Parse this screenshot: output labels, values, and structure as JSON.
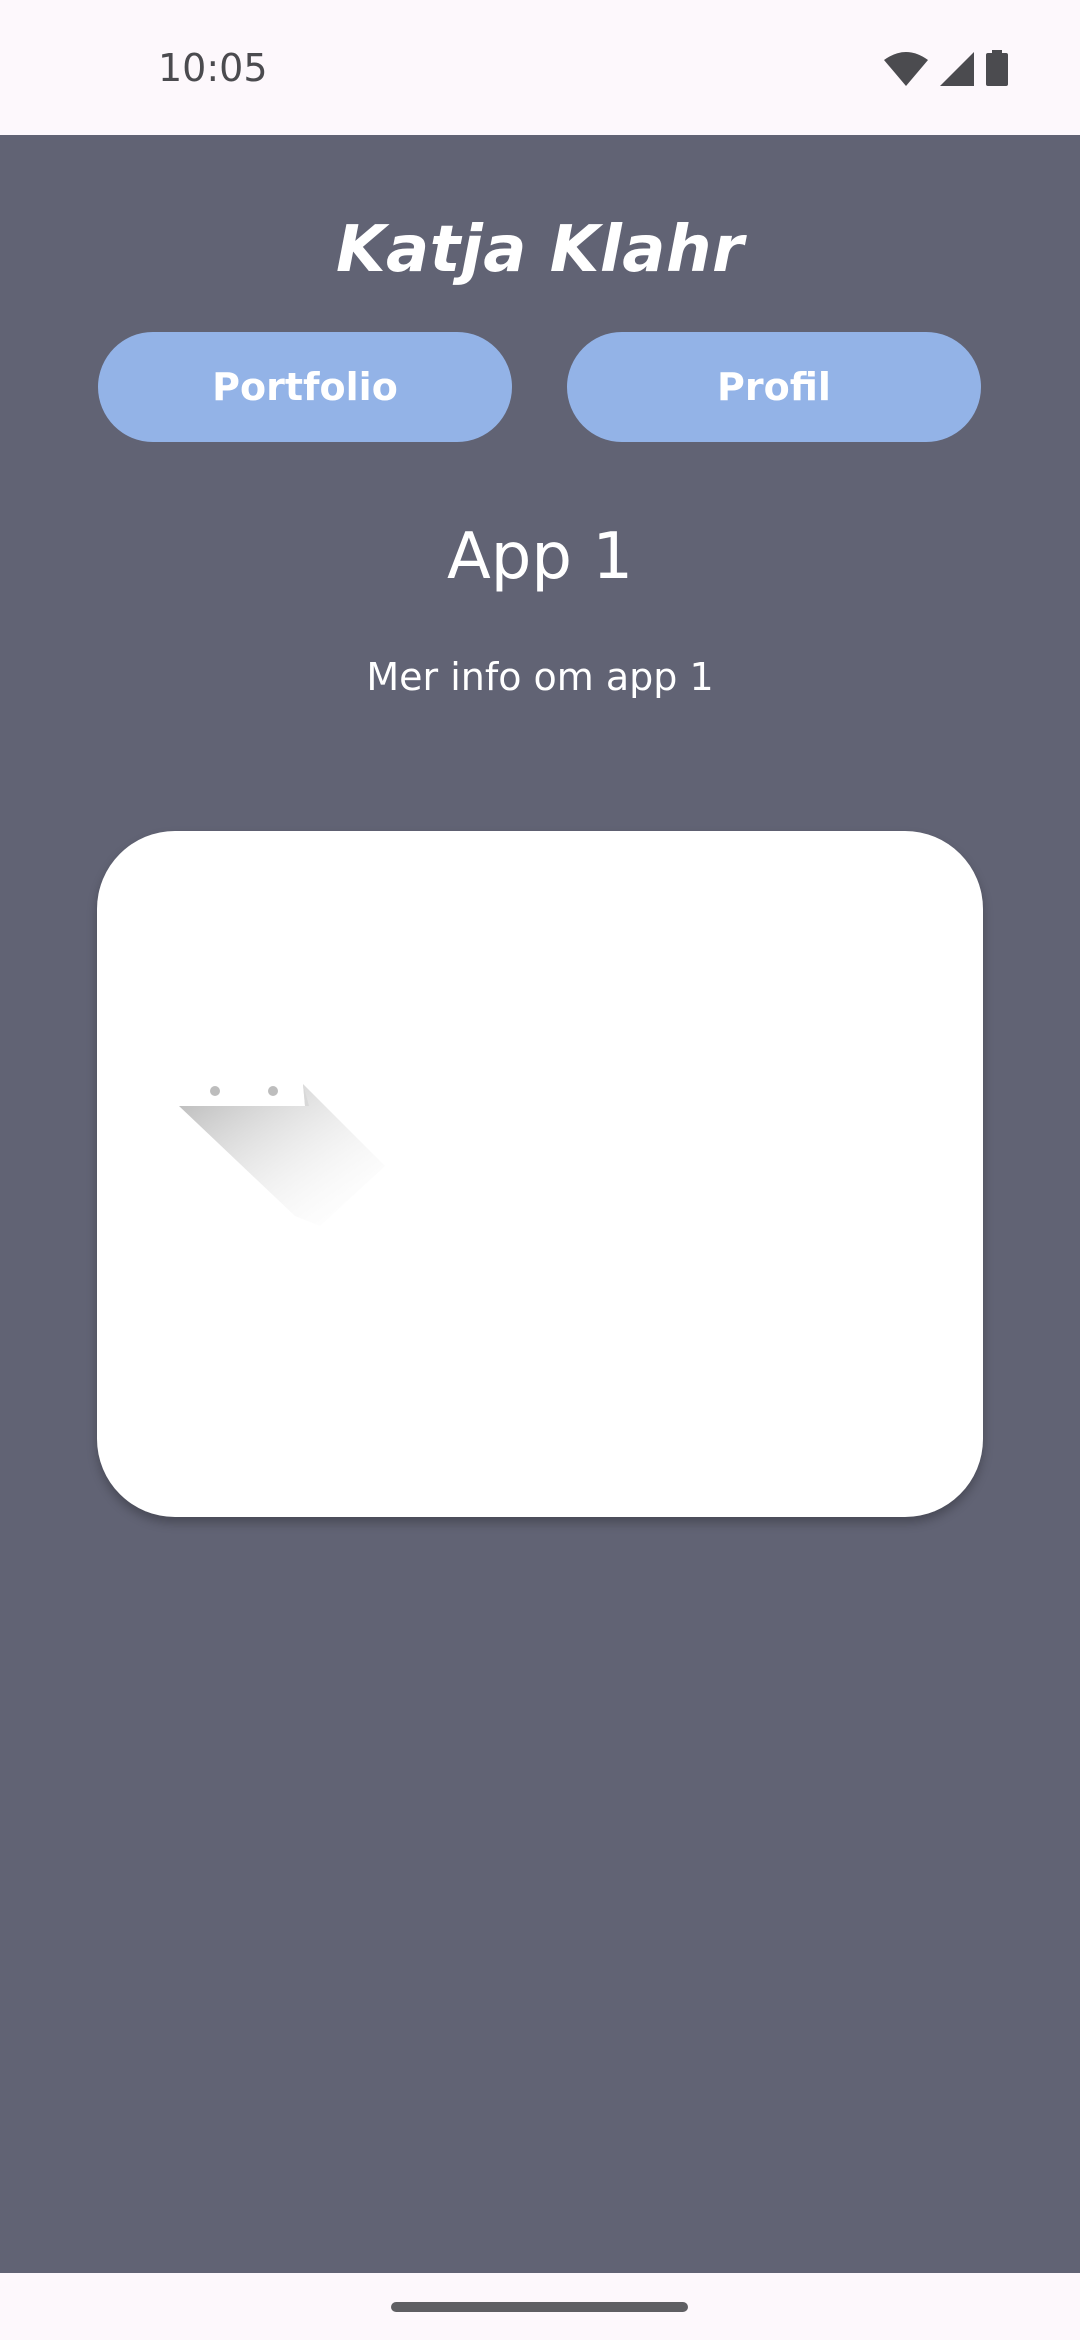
{
  "status_bar": {
    "time": "10:05",
    "icons": [
      "wifi-icon",
      "cell-signal-icon",
      "battery-icon"
    ]
  },
  "header": {
    "title": "Katja Klahr"
  },
  "nav": {
    "portfolio_label": "Portfolio",
    "profil_label": "Profil"
  },
  "content": {
    "heading": "App 1",
    "info": "Mer info om app 1",
    "media_icon": "image-placeholder-icon"
  },
  "colors": {
    "background": "#616374",
    "button": "#93b3e7",
    "card": "#ffffff",
    "system_bar": "#fdf8fc"
  }
}
